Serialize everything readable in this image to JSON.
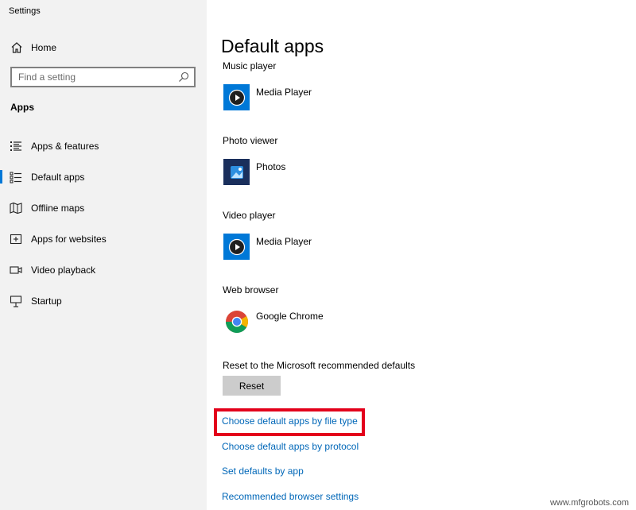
{
  "window": {
    "title": "Settings"
  },
  "sidebar": {
    "home_label": "Home",
    "search_placeholder": "Find a setting",
    "section_title": "Apps",
    "items": [
      {
        "label": "Apps & features",
        "icon": "list-icon",
        "active": false
      },
      {
        "label": "Default apps",
        "icon": "default-apps-icon",
        "active": true
      },
      {
        "label": "Offline maps",
        "icon": "map-icon",
        "active": false
      },
      {
        "label": "Apps for websites",
        "icon": "web-apps-icon",
        "active": false
      },
      {
        "label": "Video playback",
        "icon": "video-icon",
        "active": false
      },
      {
        "label": "Startup",
        "icon": "startup-icon",
        "active": false
      }
    ]
  },
  "main": {
    "title": "Default apps",
    "categories": [
      {
        "label": "Music player",
        "app": "Media Player",
        "icon": "media-player-icon"
      },
      {
        "label": "Photo viewer",
        "app": "Photos",
        "icon": "photos-icon"
      },
      {
        "label": "Video player",
        "app": "Media Player",
        "icon": "media-player-icon"
      },
      {
        "label": "Web browser",
        "app": "Google Chrome",
        "icon": "chrome-icon"
      }
    ],
    "reset": {
      "label": "Reset to the Microsoft recommended defaults",
      "button_label": "Reset"
    },
    "links": [
      "Choose default apps by file type",
      "Choose default apps by protocol",
      "Set defaults by app",
      "Recommended browser settings"
    ]
  },
  "watermark": "www.mfgrobots.com",
  "colors": {
    "accent": "#0078d7",
    "link": "#0067b8",
    "highlight": "#e3001b",
    "sidebar_bg": "#f2f2f2",
    "button_bg": "#cccccc"
  }
}
